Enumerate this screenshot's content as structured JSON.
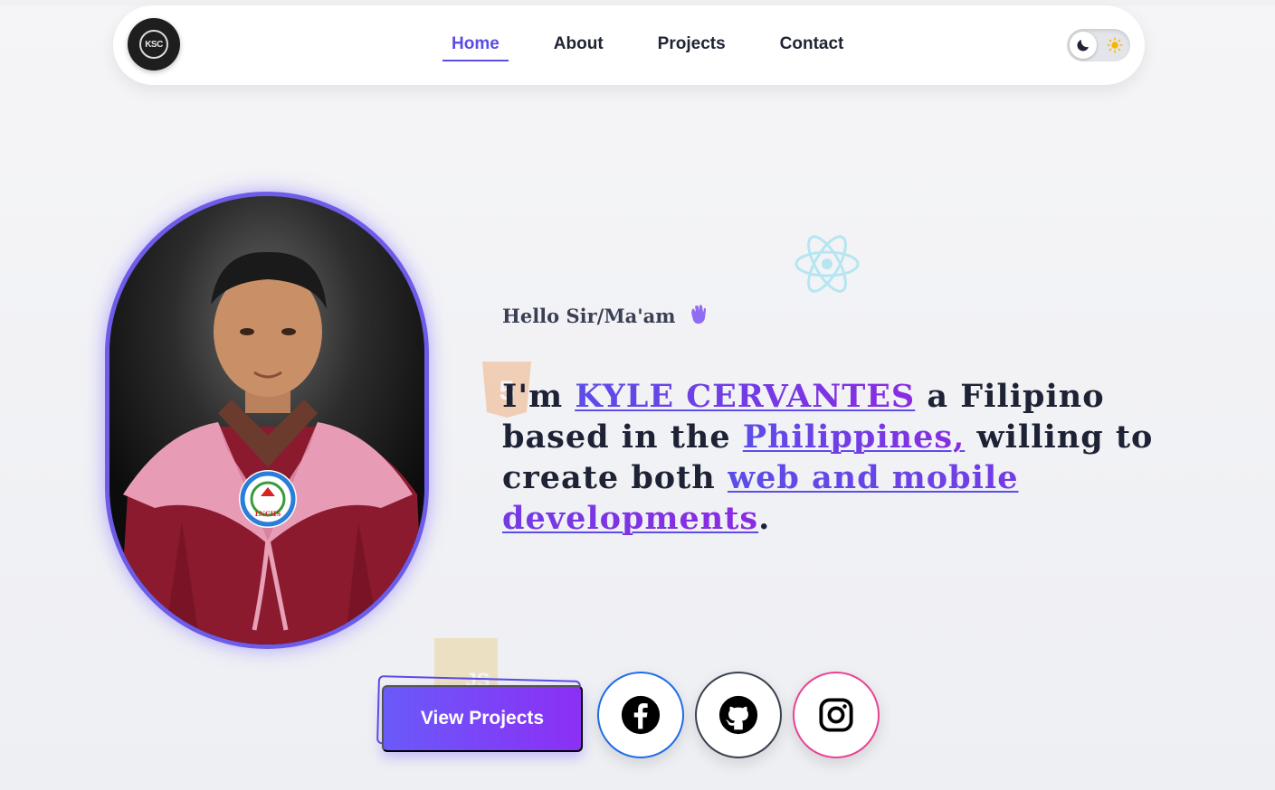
{
  "nav": {
    "logo_text": "KSC",
    "links": [
      {
        "label": "Home",
        "active": true
      },
      {
        "label": "About",
        "active": false
      },
      {
        "label": "Projects",
        "active": false
      },
      {
        "label": "Contact",
        "active": false
      }
    ],
    "theme_toggle": {
      "icons": [
        "moon-icon",
        "sun-icon"
      ],
      "mode": "light"
    }
  },
  "hero": {
    "greeting": "Hello Sir/Ma'am",
    "greeting_icon": "waving-hand-icon",
    "intro_parts": {
      "p1": "I'm ",
      "name": "KYLE CERVANTES",
      "p2": " a Filipino based in the ",
      "country": "Philippines,",
      "p3": " willing to create both ",
      "skills": "web and mobile developments",
      "p4": "."
    },
    "badge_text": "LNCHS",
    "floating_icons": [
      "react-icon",
      "html5-icon",
      "javascript-icon"
    ],
    "html_badge": "5",
    "js_badge": "JS"
  },
  "actions": {
    "view_projects_label": "View Projects",
    "social": [
      {
        "name": "facebook",
        "icon": "facebook-icon",
        "color": "#1f6ce8"
      },
      {
        "name": "github",
        "icon": "github-icon",
        "color": "#3b4150"
      },
      {
        "name": "instagram",
        "icon": "instagram-icon",
        "color": "#e84393"
      }
    ]
  },
  "colors": {
    "accent": "#5a4de6",
    "gradient_end": "#8c2ff5",
    "text_dark": "#1d2235"
  }
}
